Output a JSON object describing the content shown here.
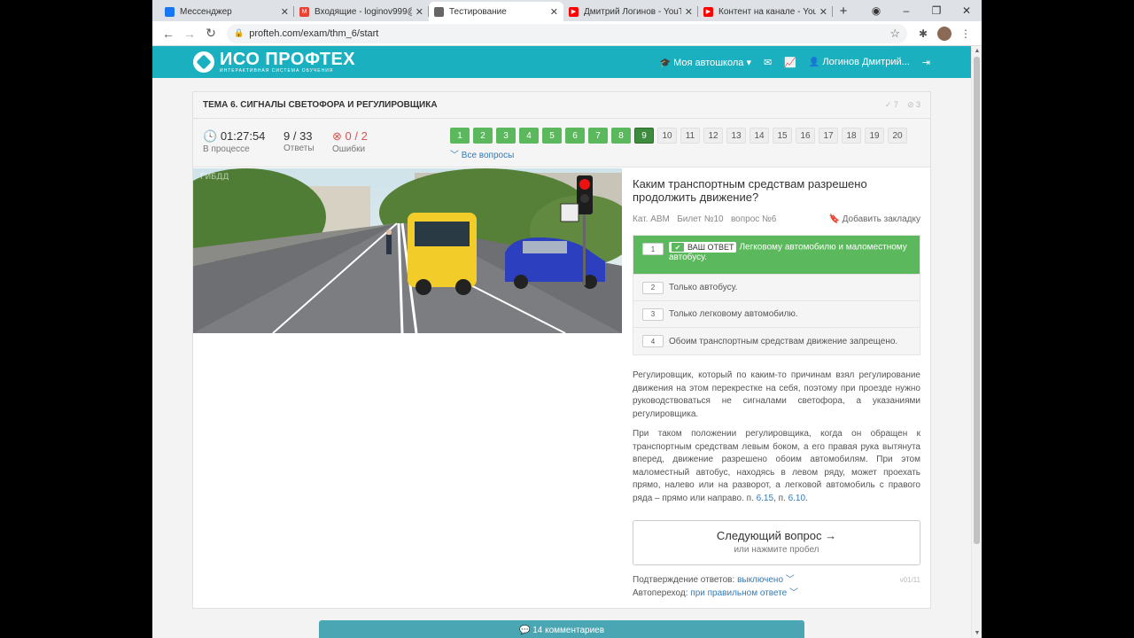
{
  "browser": {
    "tabs": [
      {
        "title": "Мессенджер",
        "color": "#1877f2",
        "glyph": ""
      },
      {
        "title": "Входящие - loginov999@",
        "color": "#ea4335",
        "glyph": "M"
      },
      {
        "title": "Тестирование",
        "color": "#666666",
        "glyph": "",
        "active": true
      },
      {
        "title": "Дмитрий Логинов - YouT",
        "color": "#ff0000",
        "glyph": "▶"
      },
      {
        "title": "Контент на канале - YouT",
        "color": "#ff0000",
        "glyph": "▶"
      }
    ],
    "url": "profteh.com/exam/thm_6/start"
  },
  "site": {
    "logo_title": "ИСО ПРОФТЕХ",
    "logo_subtitle": "ИНТЕРАКТИВНАЯ СИСТЕМА ОБУЧЕНИЯ",
    "nav_school": "Моя автошкола",
    "nav_user": "Логинов Дмитрий..."
  },
  "exam": {
    "topic": "ТЕМА 6. СИГНАЛЫ СВЕТОФОРА И РЕГУЛИРОВЩИКА",
    "correct_count": "7",
    "skipped_count": "3",
    "time": "01:27:54",
    "time_label": "В процессе",
    "answers_value": "9 / 33",
    "answers_label": "Ответы",
    "errors_value": "0 / 2",
    "errors_label": "Ошибки",
    "all_questions": "Все вопросы",
    "question_numbers": [
      {
        "n": "1",
        "state": "ok"
      },
      {
        "n": "2",
        "state": "ok"
      },
      {
        "n": "3",
        "state": "ok"
      },
      {
        "n": "4",
        "state": "ok"
      },
      {
        "n": "5",
        "state": "ok"
      },
      {
        "n": "6",
        "state": "ok"
      },
      {
        "n": "7",
        "state": "ok"
      },
      {
        "n": "8",
        "state": "ok"
      },
      {
        "n": "9",
        "state": "cur"
      },
      {
        "n": "10",
        "state": "todo"
      },
      {
        "n": "11",
        "state": "todo"
      },
      {
        "n": "12",
        "state": "todo"
      },
      {
        "n": "13",
        "state": "todo"
      },
      {
        "n": "14",
        "state": "todo"
      },
      {
        "n": "15",
        "state": "todo"
      },
      {
        "n": "16",
        "state": "todo"
      },
      {
        "n": "17",
        "state": "todo"
      },
      {
        "n": "18",
        "state": "todo"
      },
      {
        "n": "19",
        "state": "todo"
      },
      {
        "n": "20",
        "state": "todo"
      }
    ]
  },
  "question": {
    "title": "Каким транспортным средствам разрешено продолжить движение?",
    "meta": "Кат. ABM   Билет №10   вопрос №6",
    "bookmark": "Добавить закладку",
    "your_answer_label": "ВАШ ОТВЕТ",
    "answers": [
      {
        "num": "1",
        "text": "Легковому автомобилю и маломестному автобусу.",
        "correct": true
      },
      {
        "num": "2",
        "text": "Только автобусу."
      },
      {
        "num": "3",
        "text": "Только легковому автомобилю."
      },
      {
        "num": "4",
        "text": "Обоим транспортным средствам движение запрещено."
      }
    ],
    "explanation_1": "Регулировщик, который по каким-то причинам взял регулирование движения на этом перекрестке на себя, поэтому при проезде нужно руководствоваться не сигналами светофора, а указаниями регулировщика.",
    "explanation_2": "При таком положении регулировщика, когда он обращен к транспортным средствам левым боком, а его правая рука вытянута вперед, движение разрешено обоим автомобилям. При этом маломестный автобус, находясь в левом ряду, может проехать прямо, налево или на разворот, а легковой автомобиль с правого ряда – прямо или направо. п.",
    "ref_1": "6.15",
    "ref_2": "6.10",
    "next_label": "Следующий вопрос →",
    "next_hint": "или нажмите пробел",
    "confirm_label": "Подтверждение ответов:",
    "confirm_value": "выключено",
    "auto_label": "Автопереход:",
    "auto_value": "при правильном ответе",
    "version": "v01/11",
    "comments": "14 комментариев"
  }
}
